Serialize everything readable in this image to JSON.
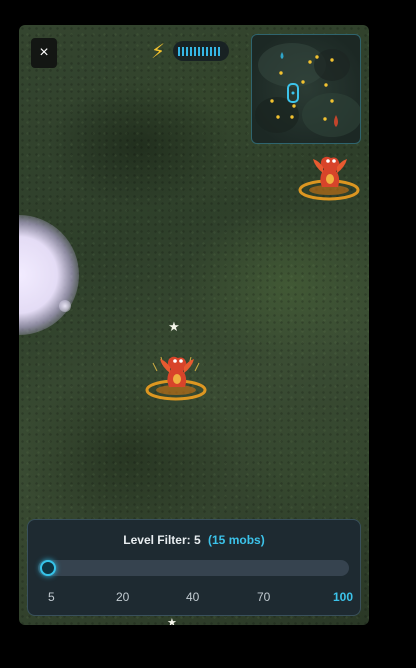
{
  "hud": {
    "close_label": "×",
    "energy_level": 0.95
  },
  "minimap": {
    "player_marker": "player-capsule",
    "water_marker": "water-drop"
  },
  "level_filter": {
    "label": "Level Filter:",
    "value": "5",
    "mob_count": "(15 mobs)",
    "slider_value": 5,
    "slider_min": 5,
    "slider_max": 100,
    "options": [
      {
        "label": "5",
        "value": 5,
        "active": false
      },
      {
        "label": "20",
        "value": 20,
        "active": false
      },
      {
        "label": "40",
        "value": 40,
        "active": false
      },
      {
        "label": "70",
        "value": 70,
        "active": false
      },
      {
        "label": "100",
        "value": 100,
        "active": true
      }
    ]
  },
  "colors": {
    "accent": "#3cc3ea",
    "energy": "#f2c230",
    "mob_ring": "#f0a020",
    "map_dot": "#f2c230"
  }
}
